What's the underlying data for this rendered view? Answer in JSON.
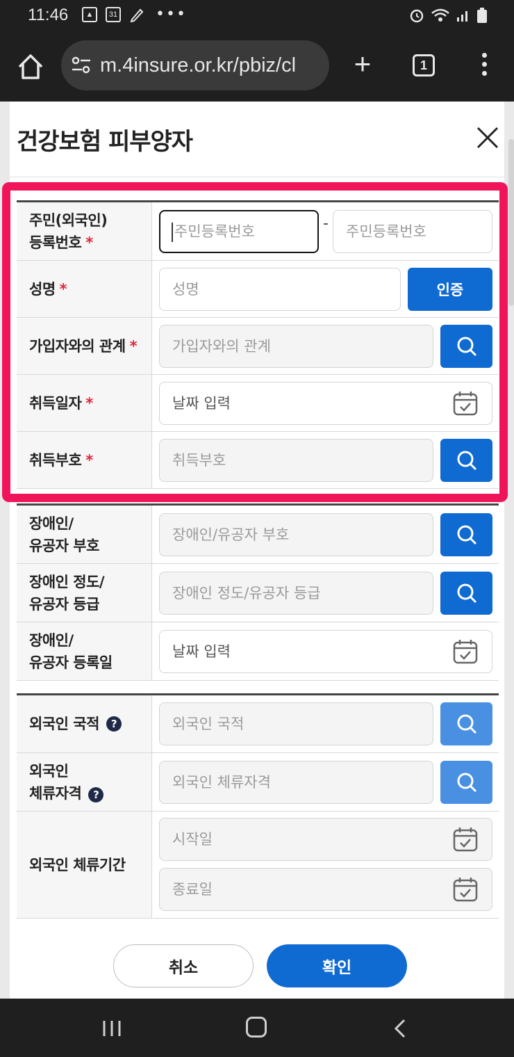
{
  "status_bar": {
    "time": "11:46",
    "calendar_day": "31"
  },
  "browser": {
    "url": "m.4insure.or.kr/pbiz/cl",
    "tab_count": "1"
  },
  "dialog": {
    "title": "건강보험 피부양자",
    "required_mark": "*",
    "fields": {
      "rrn": {
        "label_line1": "주민(외국인)",
        "label_line2": "등록번호",
        "placeholder_front": "주민등록번호",
        "dash": "-",
        "placeholder_back": "주민등록번호"
      },
      "name": {
        "label": "성명",
        "placeholder": "성명",
        "button": "인증"
      },
      "relation": {
        "label": "가입자와의 관계",
        "placeholder": "가입자와의 관계"
      },
      "acquire_date": {
        "label": "취득일자",
        "placeholder": "날짜 입력"
      },
      "acquire_code": {
        "label": "취득부호",
        "placeholder": "취득부호"
      },
      "disability_code": {
        "label_line1": "장애인/",
        "label_line2": "유공자 부호",
        "placeholder": "장애인/유공자 부호"
      },
      "disability_grade": {
        "label_line1": "장애인 정도/",
        "label_line2": "유공자 등급",
        "placeholder": "장애인 정도/유공자 등급"
      },
      "disability_date": {
        "label_line1": "장애인/",
        "label_line2": "유공자 등록일",
        "placeholder": "날짜 입력"
      },
      "nationality": {
        "label": "외국인 국적",
        "help": "?",
        "placeholder": "외국인 국적"
      },
      "residence_status": {
        "label_line1": "외국인",
        "label_line2": "체류자격",
        "help": "?",
        "placeholder": "외국인 체류자격"
      },
      "residence_period": {
        "label": "외국인 체류기간",
        "placeholder_start": "시작일",
        "placeholder_end": "종료일"
      }
    },
    "buttons": {
      "cancel": "취소",
      "confirm": "확인"
    }
  },
  "colors": {
    "primary": "#0f6ad1",
    "primary_light": "#4a90e2",
    "highlight": "#f0145a",
    "required": "#e0253b"
  }
}
